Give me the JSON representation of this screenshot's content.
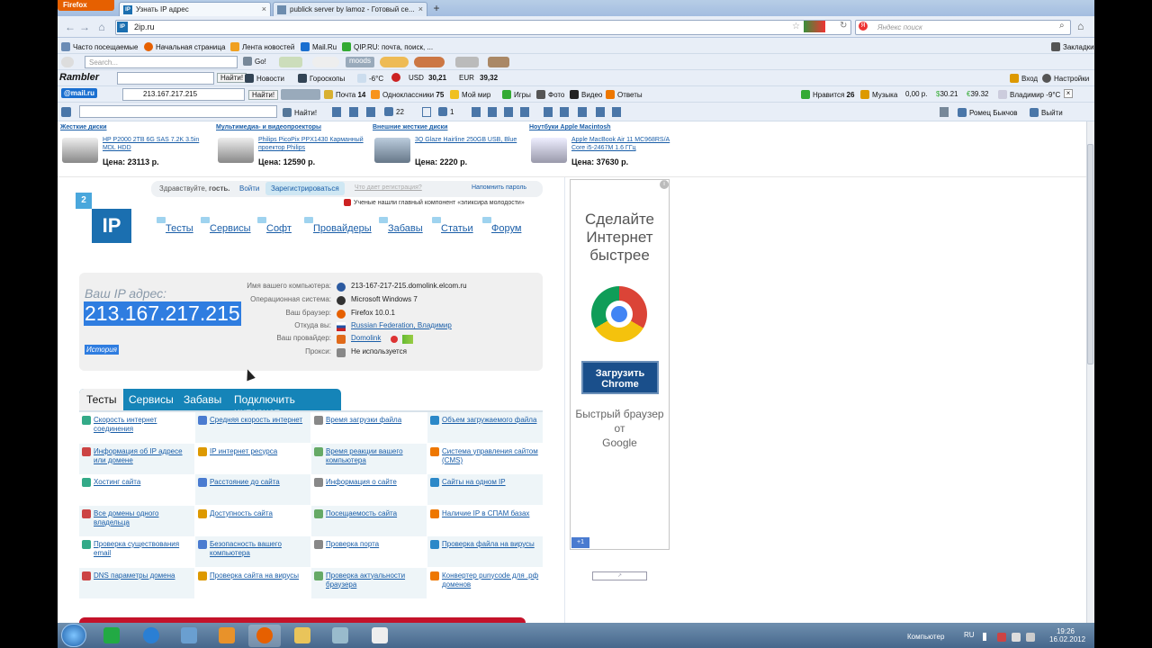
{
  "browser": {
    "menu_button": "Firefox",
    "tabs": [
      {
        "title": "Узнать IP адрес",
        "fav": "IP"
      },
      {
        "title": "publick server by lamoz - Готовый се..."
      }
    ],
    "new_tab": "+",
    "url": "2ip.ru",
    "search_placeholder": "Яндекс поиск"
  },
  "bookmarks": {
    "items": [
      "Часто посещаемые",
      "Начальная страница",
      "Лента новостей",
      "Mail.Ru",
      "QIP.RU: почта, поиск, ..."
    ],
    "right": "Закладки"
  },
  "toolbar1": {
    "search_placeholder": "Search...",
    "go": "Go!",
    "moods": "moods"
  },
  "rambler": {
    "logo": "Rambler",
    "find": "Найти!",
    "news": "Новости",
    "horoscopes": "Гороскопы",
    "temp": "-6°C",
    "usd_label": "USD",
    "usd": "30,21",
    "eur_label": "EUR",
    "eur": "39,32",
    "login": "Вход",
    "settings": "Настройки"
  },
  "mailbar": {
    "logo": "@mail.ru",
    "ip_value": "213.167.217.215",
    "find": "Найти!",
    "mail": "Почта",
    "mail_count": "14",
    "ok": "Одноклассники",
    "ok_count": "75",
    "myworld": "Мой мир",
    "games": "Игры",
    "photo": "Фото",
    "video": "Видео",
    "answers": "Ответы",
    "likes": "Нравится",
    "likes_count": "26",
    "music": "Музыка",
    "money": "0,00 р.",
    "usd": "30.21",
    "eur": "39.32",
    "city_temp": "Владимир -9°C"
  },
  "vkbar": {
    "find": "Найти!",
    "count1": "22",
    "count2": "1",
    "user": "Ромец Быкчов",
    "logout": "Выйти"
  },
  "products": [
    {
      "category": "Жесткие диски",
      "name": "HP P2000 2TB 6G SAS 7.2K 3.5in MDL HDD",
      "price": "Цена: 23113 р."
    },
    {
      "category": "Мультимедиа- и видеопроекторы",
      "name": "Philips PicoPix PPX1430 Карманный проектор Philips",
      "price": "Цена: 12590 р."
    },
    {
      "category": "Внешние жесткие диски",
      "name": "3Q Glaze Hairline 250GB USB, Blue",
      "price": "Цена: 2220 р."
    },
    {
      "category": "Ноутбуки Apple Macintosh",
      "name": "Apple MacBook Air 11 MC968RS/A Core i5-2467M 1.6 ГГц",
      "price": "Цена: 37630 р."
    }
  ],
  "site": {
    "greeting": "Здравствуйте,",
    "guest": "гость.",
    "login": "Войти",
    "register": "Зарегистрироваться",
    "why_register": "Что дает регистрация?",
    "remind": "Напомнить пароль",
    "slogan": "Ученые нашли главный компонент «эликсира молодости»",
    "logo_small": "2",
    "logo_big": "IP",
    "menu": [
      "Тесты",
      "Сервисы",
      "Софт",
      "Провайдеры",
      "Забавы",
      "Статьи",
      "Форум"
    ],
    "your_ip_label": "Ваш IP адрес:",
    "your_ip": "213.167.217.215",
    "history": "История",
    "info": [
      {
        "label": "Имя вашего компьютера:",
        "value": "213-167-217-215.domolink.elcom.ru"
      },
      {
        "label": "Операционная система:",
        "value": "Microsoft Windows 7"
      },
      {
        "label": "Ваш браузер:",
        "value": "Firefox 10.0.1"
      },
      {
        "label": "Откуда вы:",
        "value": "Russian Federation, Владимир"
      },
      {
        "label": "Ваш провайдер:",
        "value": "Domolink"
      },
      {
        "label": "Прокси:",
        "value": "Не используется"
      }
    ],
    "tabs": [
      "Тесты",
      "Сервисы",
      "Забавы",
      "Подключить интернет"
    ],
    "tests": [
      [
        "Скорость интернет соединения",
        "Средняя скорость интернет",
        "Время загрузки файла",
        "Объем загружаемого файла"
      ],
      [
        "Информация об IP адресе или домене",
        "IP интернет ресурса",
        "Время реакции вашего компьютера",
        "Система управления сайтом (CMS)"
      ],
      [
        "Хостинг сайта",
        "Расстояние до сайта",
        "Информация о сайте",
        "Сайты на одном IP"
      ],
      [
        "Все домены одного владельца",
        "Доступность сайта",
        "Посещаемость сайта",
        "Наличие IP в СПАМ базах"
      ],
      [
        "Проверка существования email",
        "Безопасность вашего компьютера",
        "Проверка порта",
        "Проверка файла на вирусы"
      ],
      [
        "DNS параметры домена",
        "Проверка сайта на вирусы",
        "Проверка актуальности браузера",
        "Конвертер punycode для .рф доменов"
      ]
    ]
  },
  "ad": {
    "title": "Сделайте Интернет быстрее",
    "button": "Загрузить Chrome",
    "subtitle": "Быстрый браузер от",
    "brand": "Google",
    "plus": "+1"
  },
  "taskbar": {
    "computer": "Компьютер",
    "lang": "RU",
    "time": "19:26",
    "date": "16.02.2012"
  },
  "colors": {
    "accent": "#1b6fb0",
    "tabs": "#1584b8",
    "ip_highlight": "#2f7de0",
    "firefox": "#e66000"
  }
}
